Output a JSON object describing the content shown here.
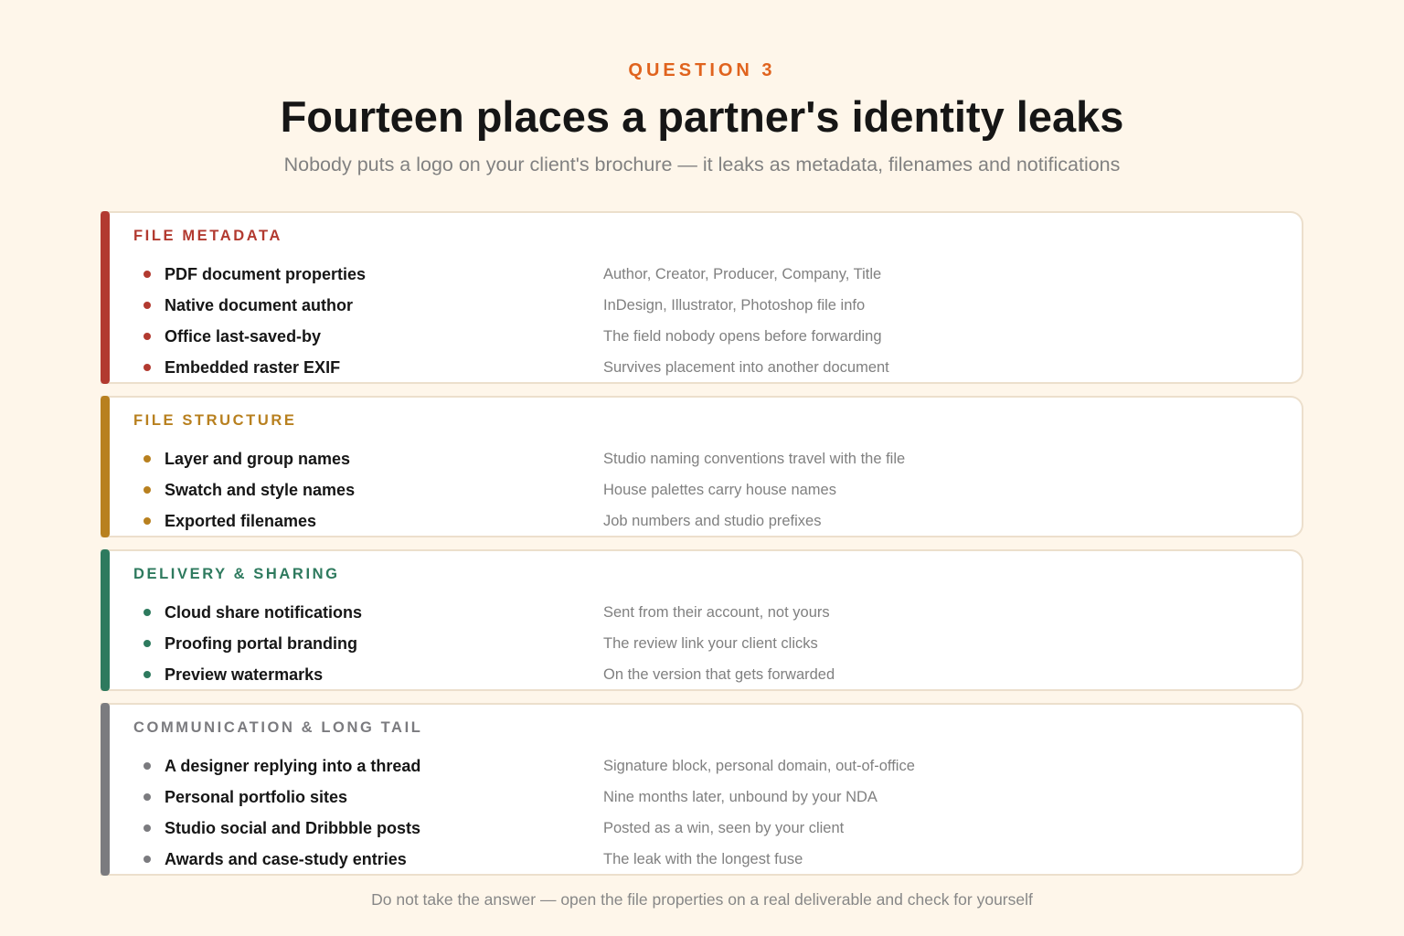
{
  "header": {
    "eyebrow": "QUESTION 3",
    "title": "Fourteen places a partner's identity leaks",
    "subtitle": "Nobody puts a logo on your client's brochure — it leaks as metadata, filenames and notifications"
  },
  "sections": [
    {
      "title": "FILE METADATA",
      "color": "#b23a30",
      "items": [
        {
          "label": "PDF document properties",
          "desc": "Author, Creator, Producer, Company, Title"
        },
        {
          "label": "Native document author",
          "desc": "InDesign, Illustrator, Photoshop file info"
        },
        {
          "label": "Office last-saved-by",
          "desc": "The field nobody opens before forwarding"
        },
        {
          "label": "Embedded raster EXIF",
          "desc": "Survives placement into another document"
        }
      ]
    },
    {
      "title": "FILE STRUCTURE",
      "color": "#b8801f",
      "items": [
        {
          "label": "Layer and group names",
          "desc": "Studio naming conventions travel with the file"
        },
        {
          "label": "Swatch and style names",
          "desc": "House palettes carry house names"
        },
        {
          "label": "Exported filenames",
          "desc": "Job numbers and studio prefixes"
        }
      ]
    },
    {
      "title": "DELIVERY & SHARING",
      "color": "#2e7a5e",
      "items": [
        {
          "label": "Cloud share notifications",
          "desc": "Sent from their account, not yours"
        },
        {
          "label": "Proofing portal branding",
          "desc": "The review link your client clicks"
        },
        {
          "label": "Preview watermarks",
          "desc": "On the version that gets forwarded"
        }
      ]
    },
    {
      "title": "COMMUNICATION & LONG TAIL",
      "color": "#7b7b7f",
      "items": [
        {
          "label": "A designer replying into a thread",
          "desc": "Signature block, personal domain, out-of-office"
        },
        {
          "label": "Personal portfolio sites",
          "desc": "Nine months later, unbound by your NDA"
        },
        {
          "label": "Studio social and Dribbble posts",
          "desc": "Posted as a win, seen by your client"
        },
        {
          "label": "Awards and case-study entries",
          "desc": "The leak with the longest fuse"
        }
      ]
    }
  ],
  "footer": "Do not take the answer — open the file properties on a real deliverable and check for yourself"
}
